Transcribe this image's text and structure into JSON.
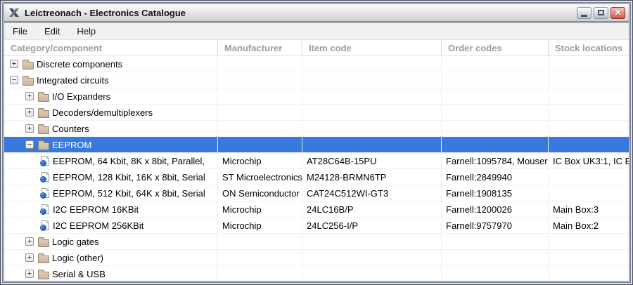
{
  "window": {
    "title": "Leictreonach - Electronics Catalogue",
    "icon": "x11-logo-icon",
    "controls": {
      "minimize": "minimize",
      "maximize": "maximize",
      "close": "✕"
    }
  },
  "menu": {
    "items": [
      "File",
      "Edit",
      "Help"
    ]
  },
  "table": {
    "columns": [
      {
        "label": "Category/component"
      },
      {
        "label": "Manufacturer"
      },
      {
        "label": "Item code"
      },
      {
        "label": "Order codes"
      },
      {
        "label": "Stock locations"
      }
    ],
    "rows": [
      {
        "type": "folder",
        "level": 0,
        "expander": "+",
        "selected": false,
        "label": "Discrete components",
        "cells": [
          "",
          "",
          "",
          ""
        ]
      },
      {
        "type": "folder",
        "level": 0,
        "expander": "-",
        "selected": false,
        "label": "Integrated circuits",
        "cells": [
          "",
          "",
          "",
          ""
        ]
      },
      {
        "type": "folder",
        "level": 1,
        "expander": "+",
        "selected": false,
        "label": "I/O Expanders",
        "cells": [
          "",
          "",
          "",
          ""
        ]
      },
      {
        "type": "folder",
        "level": 1,
        "expander": "+",
        "selected": false,
        "label": "Decoders/demultiplexers",
        "cells": [
          "",
          "",
          "",
          ""
        ]
      },
      {
        "type": "folder",
        "level": 1,
        "expander": "+",
        "selected": false,
        "label": "Counters",
        "cells": [
          "",
          "",
          "",
          ""
        ]
      },
      {
        "type": "folder",
        "level": 1,
        "expander": "-",
        "selected": true,
        "label": "EEPROM",
        "cells": [
          "",
          "",
          "",
          ""
        ]
      },
      {
        "type": "item",
        "level": 2,
        "expander": "",
        "selected": false,
        "label": "EEPROM, 64 Kbit, 8K x 8bit, Parallel,",
        "cells": [
          "Microchip",
          "AT28C64B-15PU",
          "Farnell:1095784, Mouser",
          "IC Box UK3:1, IC E"
        ]
      },
      {
        "type": "item",
        "level": 2,
        "expander": "",
        "selected": false,
        "label": "EEPROM, 128 Kbit, 16K x 8bit, Serial",
        "cells": [
          "ST Microelectronics",
          "M24128-BRMN6TP",
          "Farnell:2849940",
          ""
        ]
      },
      {
        "type": "item",
        "level": 2,
        "expander": "",
        "selected": false,
        "label": "EEPROM, 512 Kbit, 64K x 8bit, Serial",
        "cells": [
          "ON Semiconductor",
          "CAT24C512WI-GT3",
          "Farnell:1908135",
          ""
        ]
      },
      {
        "type": "item",
        "level": 2,
        "expander": "",
        "selected": false,
        "label": "I2C EEPROM 16KBit",
        "cells": [
          "Microchip",
          "24LC16B/P",
          "Farnell:1200026",
          "Main Box:3"
        ]
      },
      {
        "type": "item",
        "level": 2,
        "expander": "",
        "selected": false,
        "label": "I2C EEPROM 256KBit",
        "cells": [
          "Microchip",
          "24LC256-I/P",
          "Farnell:9757970",
          "Main Box:2"
        ]
      },
      {
        "type": "folder",
        "level": 1,
        "expander": "+",
        "selected": false,
        "label": "Logic gates",
        "cells": [
          "",
          "",
          "",
          ""
        ]
      },
      {
        "type": "folder",
        "level": 1,
        "expander": "+",
        "selected": false,
        "label": "Logic (other)",
        "cells": [
          "",
          "",
          "",
          ""
        ]
      },
      {
        "type": "folder",
        "level": 1,
        "expander": "+",
        "selected": false,
        "label": "Serial & USB",
        "cells": [
          "",
          "",
          "",
          ""
        ]
      }
    ]
  },
  "colors": {
    "selection": "#3879dd",
    "folder": "#cdb9a2",
    "header_text": "#9b9b9b",
    "close_button": "#d8544a"
  }
}
